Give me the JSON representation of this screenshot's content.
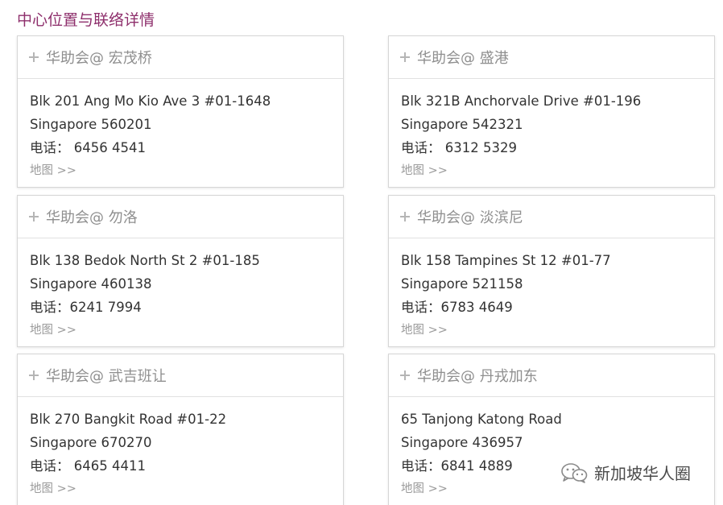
{
  "section": {
    "title": "中心位置与联络详情"
  },
  "cards": [
    {
      "title": "华助会@ 宏茂桥",
      "address": "Blk 201 Ang Mo Kio Ave 3 #01-1648",
      "postal": "Singapore 560201",
      "phone": "电话：  6456 4541",
      "map": "地图 >>"
    },
    {
      "title": "华助会@ 盛港",
      "address": "Blk 321B Anchorvale Drive #01-196",
      "postal": "Singapore 542321",
      "phone": "电话：  6312 5329",
      "map": "地图 >>"
    },
    {
      "title": "华助会@ 勿洛",
      "address": "Blk 138 Bedok North St 2 #01-185",
      "postal": "Singapore 460138",
      "phone": "电话：6241 7994",
      "map": "地图 >>"
    },
    {
      "title": "华助会@ 淡滨尼",
      "address": "Blk 158 Tampines St 12 #01-77",
      "postal": "Singapore 521158",
      "phone": "电话：6783 4649",
      "map": "地图 >>"
    },
    {
      "title": "华助会@ 武吉班让",
      "address": "Blk 270 Bangkit Road #01-22",
      "postal": "Singapore 670270",
      "phone": "电话：  6465 4411",
      "map": "地图 >>"
    },
    {
      "title": "华助会@ 丹戎加东",
      "address": "65 Tanjong Katong Road",
      "postal": "Singapore 436957",
      "phone": "电话：6841 4889",
      "map": "地图 >>"
    }
  ],
  "watermark": {
    "text": "新加坡华人圈",
    "icon": "wechat-icon"
  },
  "colors": {
    "title": "#8e2f6c",
    "card_title": "#8f8f8f",
    "text": "#333333",
    "link": "#9a9a9a",
    "border": "#d6d6d6"
  }
}
